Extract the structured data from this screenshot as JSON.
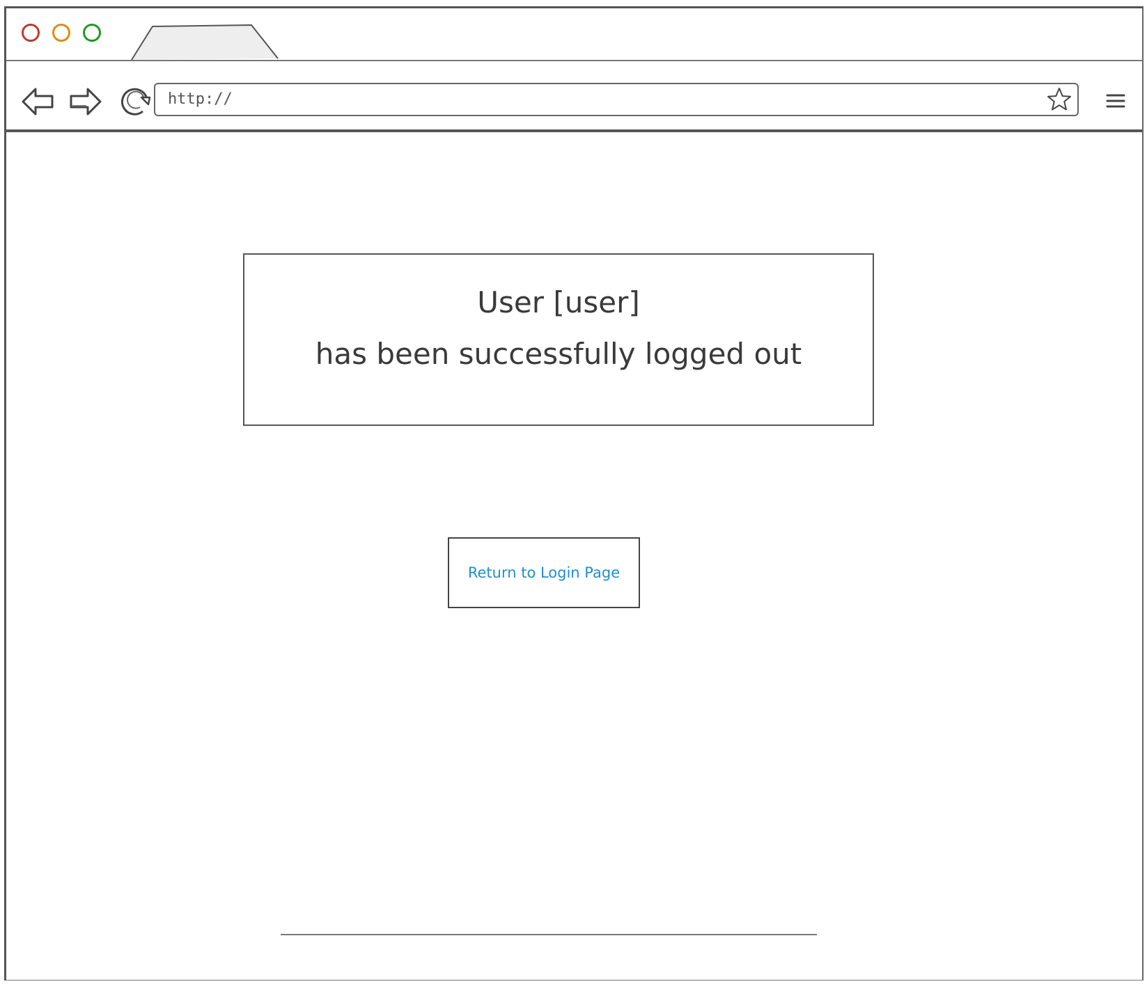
{
  "browser": {
    "address_bar": {
      "value": "http://"
    },
    "window_controls": {
      "close_color": "#c0392b",
      "minimize_color": "#e08a13",
      "maximize_color": "#1e9a1e"
    },
    "icons": {
      "back": "back-arrow-icon",
      "forward": "forward-arrow-icon",
      "refresh": "refresh-icon",
      "bookmark": "star-icon",
      "menu": "hamburger-menu-icon"
    }
  },
  "message": {
    "line1": "User [user]",
    "line2": "has been successfully logged out"
  },
  "return_button": {
    "label": "Return to Login Page",
    "color": "#1e8fd6"
  }
}
